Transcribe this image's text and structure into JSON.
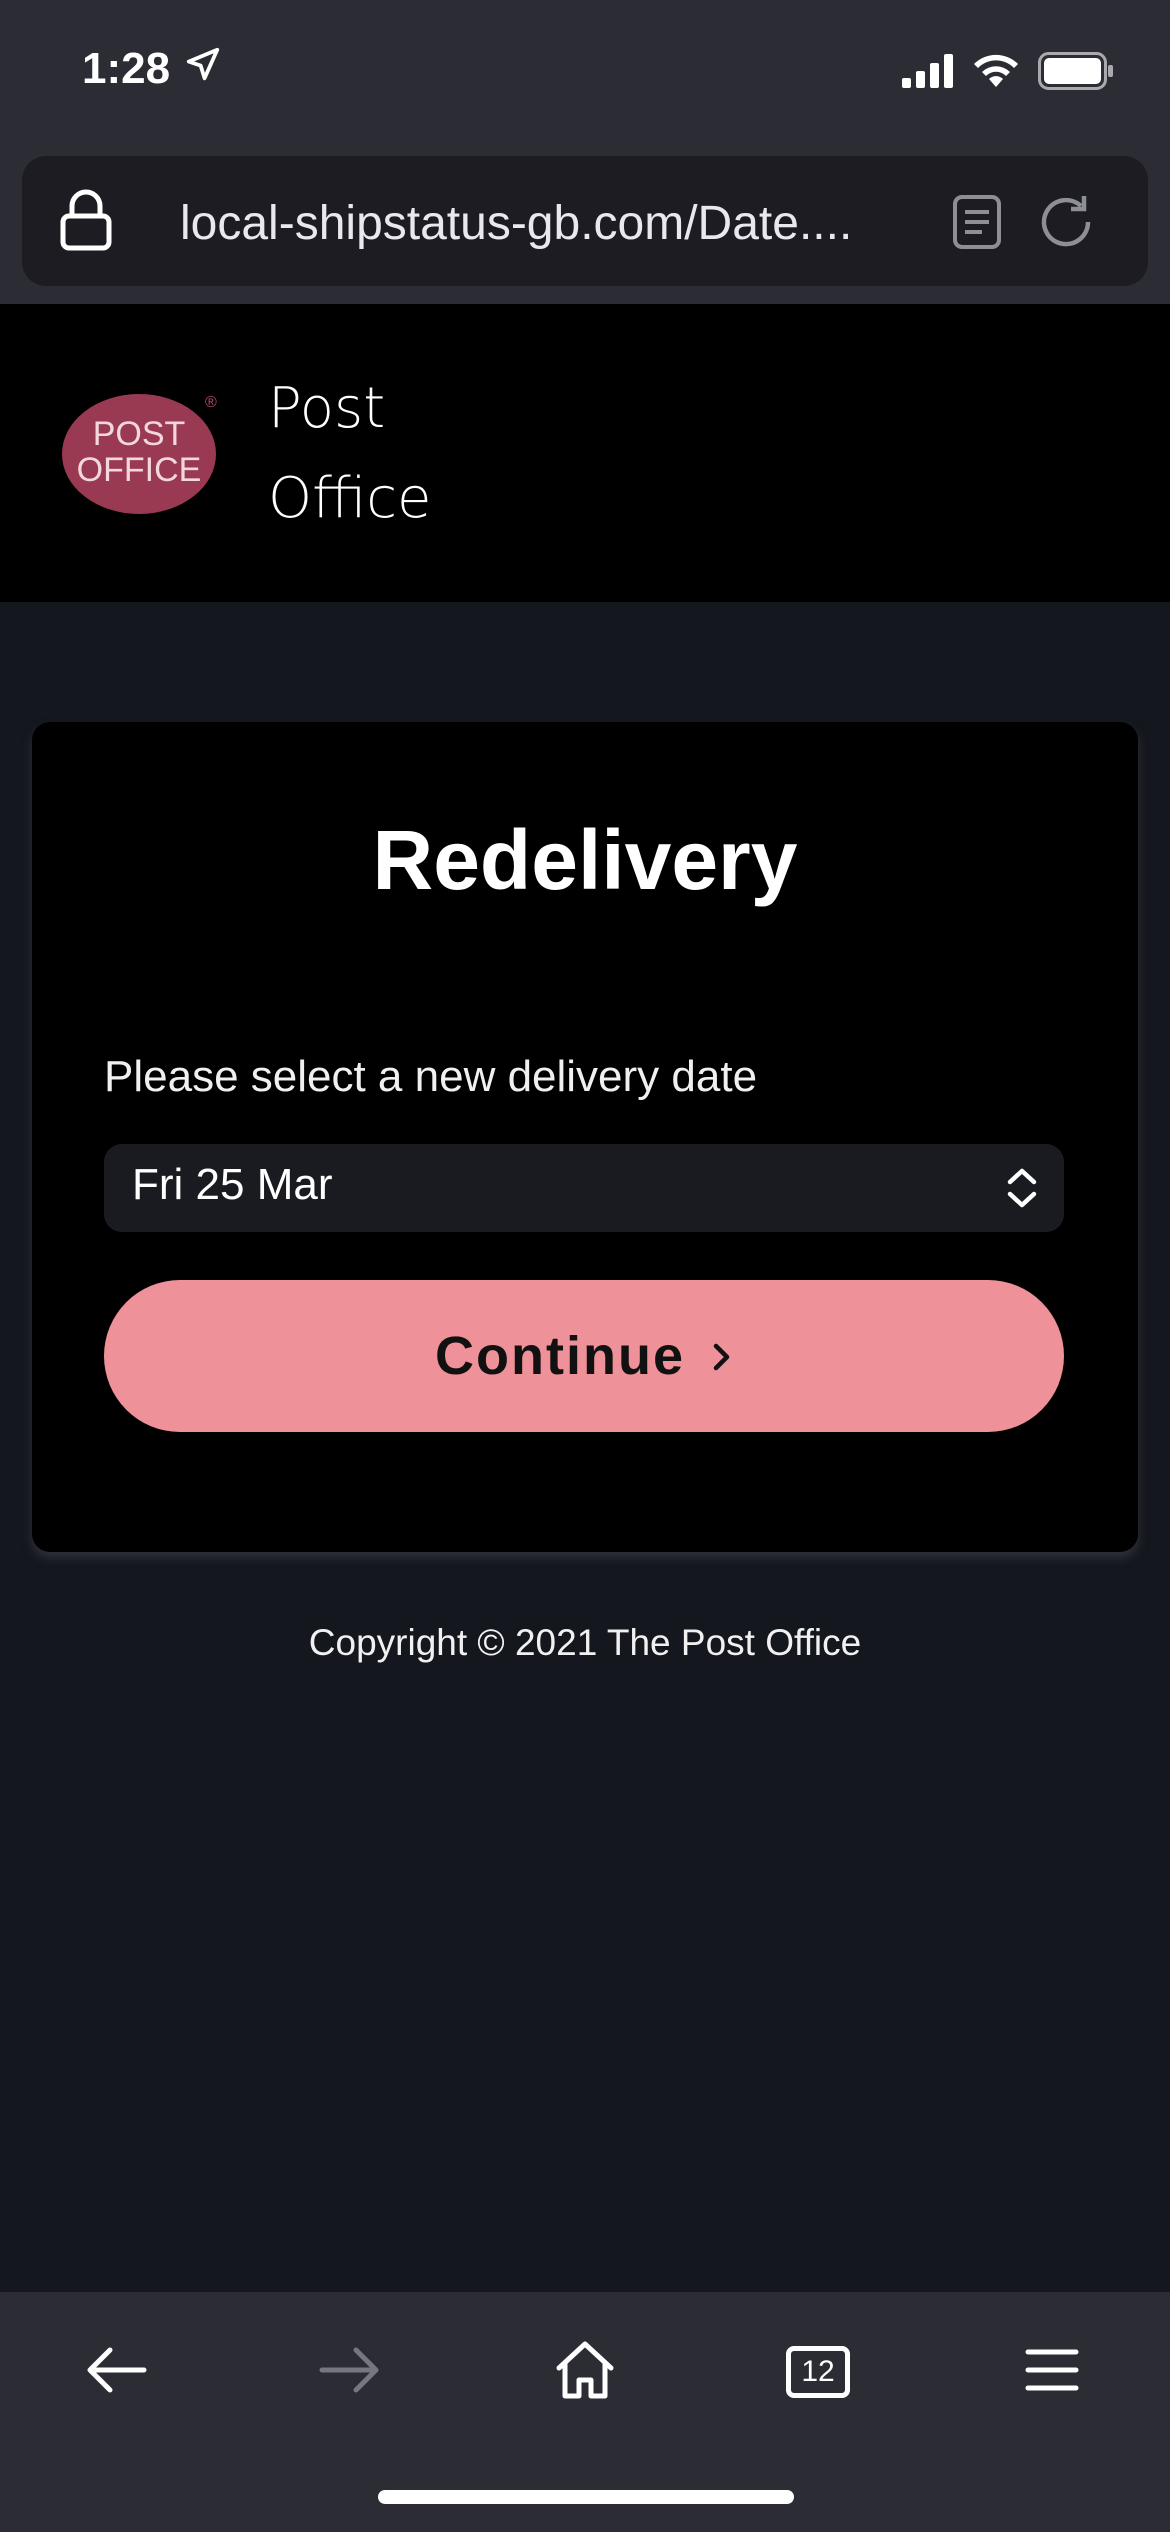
{
  "status": {
    "time": "1:28"
  },
  "browser": {
    "url": "local-shipstatus-gb.com/Date....",
    "tab_count": "12"
  },
  "site": {
    "logo_line1": "POST",
    "logo_line2": "OFFICE",
    "logo_reg": "®",
    "brand_line1": "Post",
    "brand_line2": "Office"
  },
  "card": {
    "title": "Redelivery",
    "select_label": "Please select a new delivery date",
    "selected_date": "Fri 25 Mar",
    "continue_label": "Continue"
  },
  "footer": {
    "copyright": "Copyright © 2021 The Post Office"
  },
  "colors": {
    "accent": "#ef9199",
    "logo": "#9a3a52",
    "background": "#15171e",
    "chrome": "#2c2c35"
  },
  "icons": [
    "location-arrow-icon",
    "signal-icon",
    "wifi-icon",
    "battery-icon",
    "lock-icon",
    "reader-icon",
    "reload-icon",
    "chevron-right-icon",
    "select-updown-icon",
    "back-icon",
    "forward-icon",
    "home-icon",
    "tabs-icon",
    "menu-icon"
  ]
}
